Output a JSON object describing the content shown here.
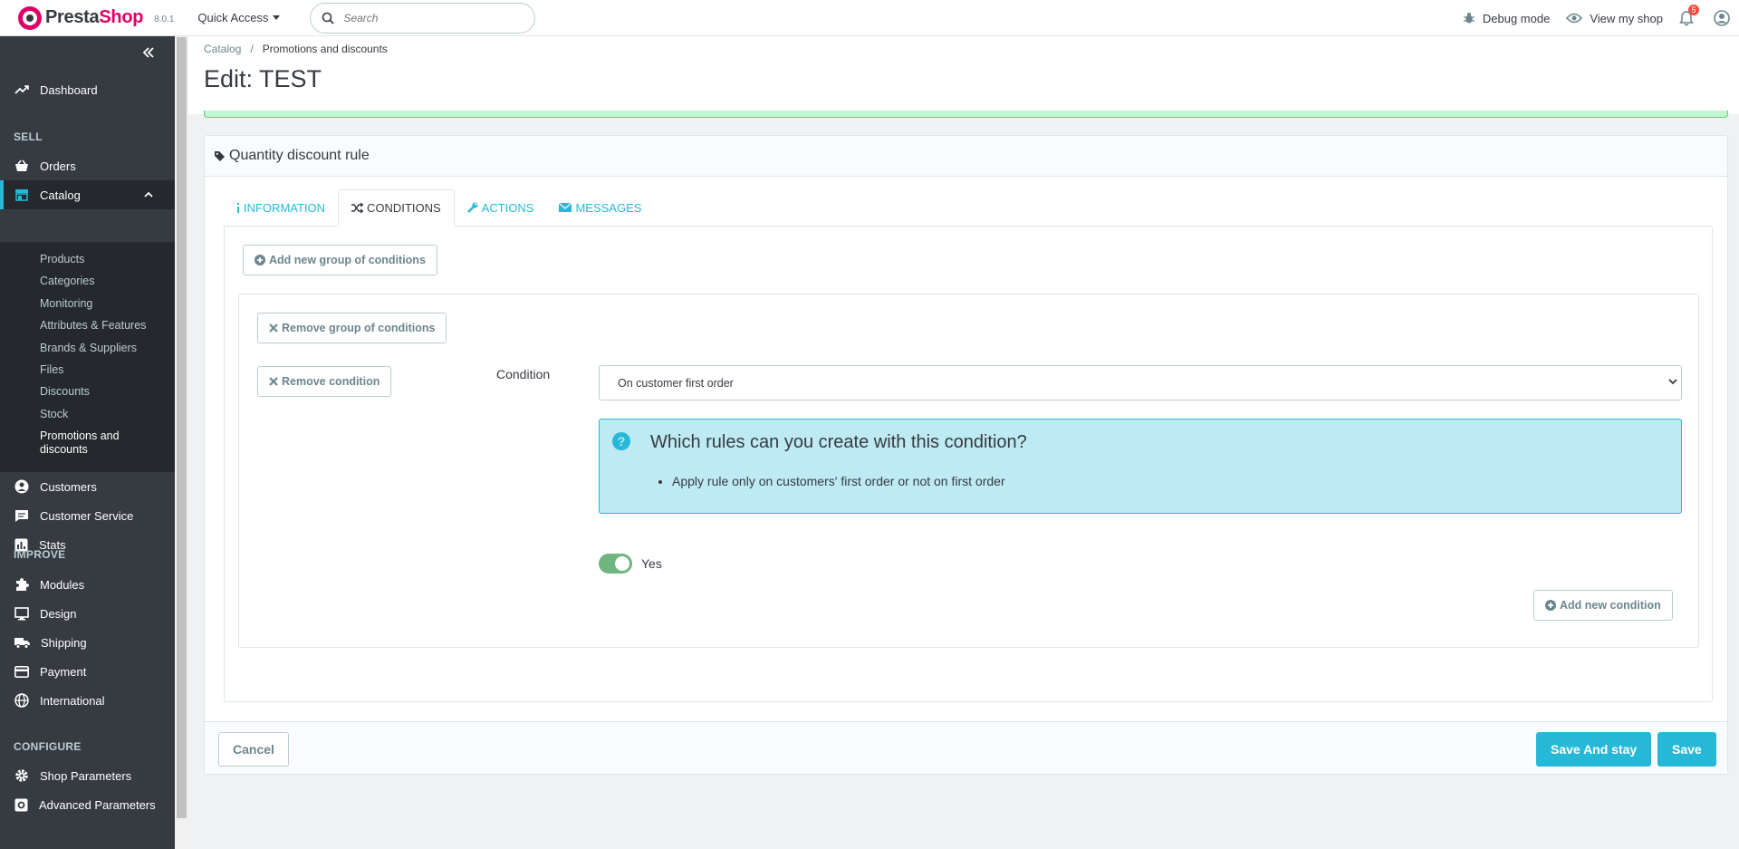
{
  "header": {
    "logo_prefix": "Presta",
    "logo_suffix": "Shop",
    "version": "8.0.1",
    "quick_access": "Quick Access",
    "search_placeholder": "Search",
    "debug_mode": "Debug mode",
    "view_shop": "View my shop",
    "notifications_count": "5"
  },
  "sidebar": {
    "dashboard": "Dashboard",
    "sections": {
      "sell": "SELL",
      "improve": "IMPROVE",
      "configure": "CONFIGURE"
    },
    "orders": "Orders",
    "catalog": "Catalog",
    "catalog_sub": [
      "Products",
      "Categories",
      "Monitoring",
      "Attributes & Features",
      "Brands & Suppliers",
      "Files",
      "Discounts",
      "Stock"
    ],
    "catalog_current_line1": "Promotions and",
    "catalog_current_line2": "discounts",
    "customers": "Customers",
    "customer_service": "Customer Service",
    "stats": "Stats",
    "modules": "Modules",
    "design": "Design",
    "shipping": "Shipping",
    "payment": "Payment",
    "international": "International",
    "shop_parameters": "Shop Parameters",
    "advanced_parameters": "Advanced Parameters"
  },
  "breadcrumb": {
    "first": "Catalog",
    "separator": "/",
    "last": "Promotions and discounts"
  },
  "page_title": "Edit: TEST",
  "panel": {
    "heading": "Quantity discount rule",
    "tabs": [
      "INFORMATION",
      "CONDITIONS",
      "ACTIONS",
      "MESSAGES"
    ],
    "add_group": "Add new group of conditions",
    "remove_group": "Remove group of conditions",
    "remove_condition": "Remove condition",
    "condition_label": "Condition",
    "condition_value": "On customer first order",
    "help_title": "Which rules can you create with this condition?",
    "help_item": "Apply rule only on customers' first order or not on first order",
    "toggle_label": "Yes",
    "add_condition": "Add new condition"
  },
  "footer": {
    "cancel": "Cancel",
    "save_stay": "Save And stay",
    "save": "Save"
  },
  "colors": {
    "accent": "#25b9d7",
    "brand": "#df0067",
    "sidebar": "#363a41",
    "toggle_on": "#70b580"
  }
}
